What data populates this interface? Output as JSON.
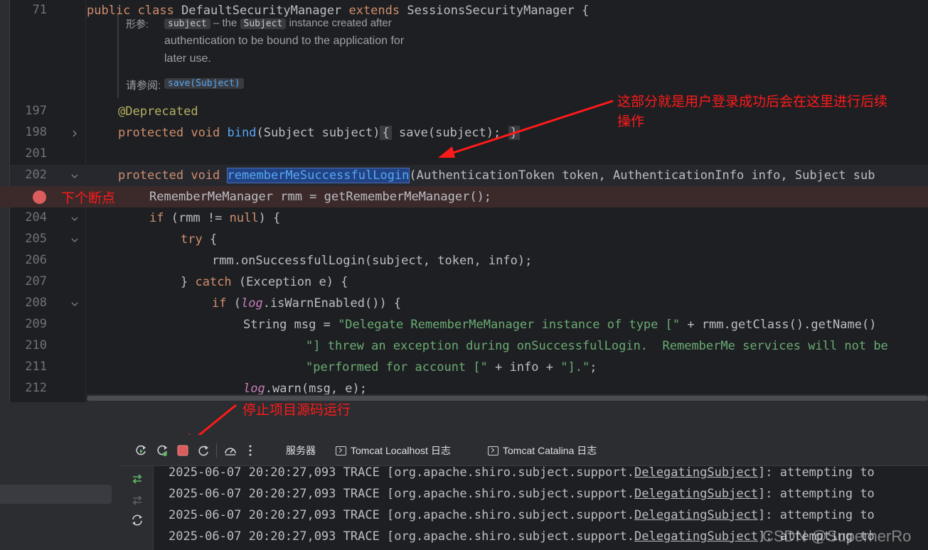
{
  "editor": {
    "gutter_top_line": "71",
    "class_header": {
      "kw1": "public class ",
      "name": "DefaultSecurityManager ",
      "kw2": "extends ",
      "parent": "SessionsSecurityManager {"
    },
    "doc": {
      "param_label": "形参:",
      "param_chip": "subject",
      "param_dash": " – the ",
      "param_chip2": "Subject",
      "param_text1": " instance created after",
      "param_text2": "authentication to be bound to the application for",
      "param_text3": "later use.",
      "see_label": "请参阅:",
      "see_link": "save(Subject)"
    },
    "lines": [
      {
        "num": "197",
        "fold": false
      },
      {
        "num": "198",
        "fold": "right"
      },
      {
        "num": "201",
        "fold": false
      },
      {
        "num": "202",
        "fold": "down"
      },
      {
        "num": "",
        "fold": false
      },
      {
        "num": "204",
        "fold": "down"
      },
      {
        "num": "205",
        "fold": "down"
      },
      {
        "num": "206",
        "fold": false
      },
      {
        "num": "207",
        "fold": false
      },
      {
        "num": "208",
        "fold": "down"
      },
      {
        "num": "209",
        "fold": false
      },
      {
        "num": "210",
        "fold": false
      },
      {
        "num": "211",
        "fold": false
      },
      {
        "num": "212",
        "fold": false
      }
    ],
    "code": {
      "l197": "@Deprecated",
      "l198_kw": "protected void ",
      "l198_fn": "bind",
      "l198_args": "(Subject subject)",
      "l198_open": "{",
      "l198_body": " save(subject); ",
      "l198_close": "}",
      "l202_kw": "protected void ",
      "l202_fn": "rememberMeSuccessfulLogin",
      "l202_args": "(AuthenticationToken token, AuthenticationInfo info, Subject sub",
      "l203": "RememberMeManager rmm = getRememberMeManager();",
      "l204_kw": "if ",
      "l204_rest": "(rmm != ",
      "l204_null": "null",
      "l204_end": ") {",
      "l205_kw": "try ",
      "l205_end": "{",
      "l206": "rmm.onSuccessfulLogin(subject, token, info);",
      "l207_a": "} ",
      "l207_kw": "catch ",
      "l207_b": "(Exception e) {",
      "l208_kw": "if ",
      "l208_a": "(",
      "l208_log": "log",
      "l208_b": ".isWarnEnabled()) {",
      "l209_a": "String msg = ",
      "l209_str": "\"Delegate RememberMeManager instance of type [\"",
      "l209_b": " + rmm.getClass().getName()",
      "l210_str": "\"] threw an exception during onSuccessfulLogin.  RememberMe services will not be",
      "l211_str": "\"performed for account [\"",
      "l211_b": " + info + ",
      "l211_str2": "\"].\"",
      "l211_c": ";",
      "l212_log": "log",
      "l212_b": ".warn(msg, e);"
    }
  },
  "annotations": {
    "top_note_line1": "这部分就是用户登录成功后会在这里进行后续",
    "top_note_line2": "操作",
    "breakpoint_note": "下个断点",
    "stop_note": "停止项目源码运行"
  },
  "panel": {
    "tabs": [
      {
        "label": "服务器"
      },
      {
        "label": "Tomcat Localhost 日志"
      },
      {
        "label": "Tomcat Catalina 日志"
      }
    ],
    "log_lines": [
      {
        "pre": "2025-06-07 20:20:27,093 TRACE [org.apache.shiro.subject.support.",
        "cls": "DelegatingSubject",
        "post": "]: attempting to"
      },
      {
        "pre": "2025-06-07 20:20:27,093 TRACE [org.apache.shiro.subject.support.",
        "cls": "DelegatingSubject",
        "post": "]: attempting to"
      },
      {
        "pre": "2025-06-07 20:20:27,093 TRACE [org.apache.shiro.subject.support.",
        "cls": "DelegatingSubject",
        "post": "]: attempting to"
      },
      {
        "pre": "2025-06-07 20:20:27,093 TRACE [org.apache.shiro.subject.support.",
        "cls": "DelegatingSubject",
        "post": "]: attempting to"
      }
    ],
    "watermark": "CSDN @SuperherRo"
  },
  "colors": {
    "keyword": "#cf8e6d",
    "function": "#56a8f5",
    "string": "#6aab73",
    "annotation_red": "#ff1a1a",
    "breakpoint": "#db5c5c"
  }
}
